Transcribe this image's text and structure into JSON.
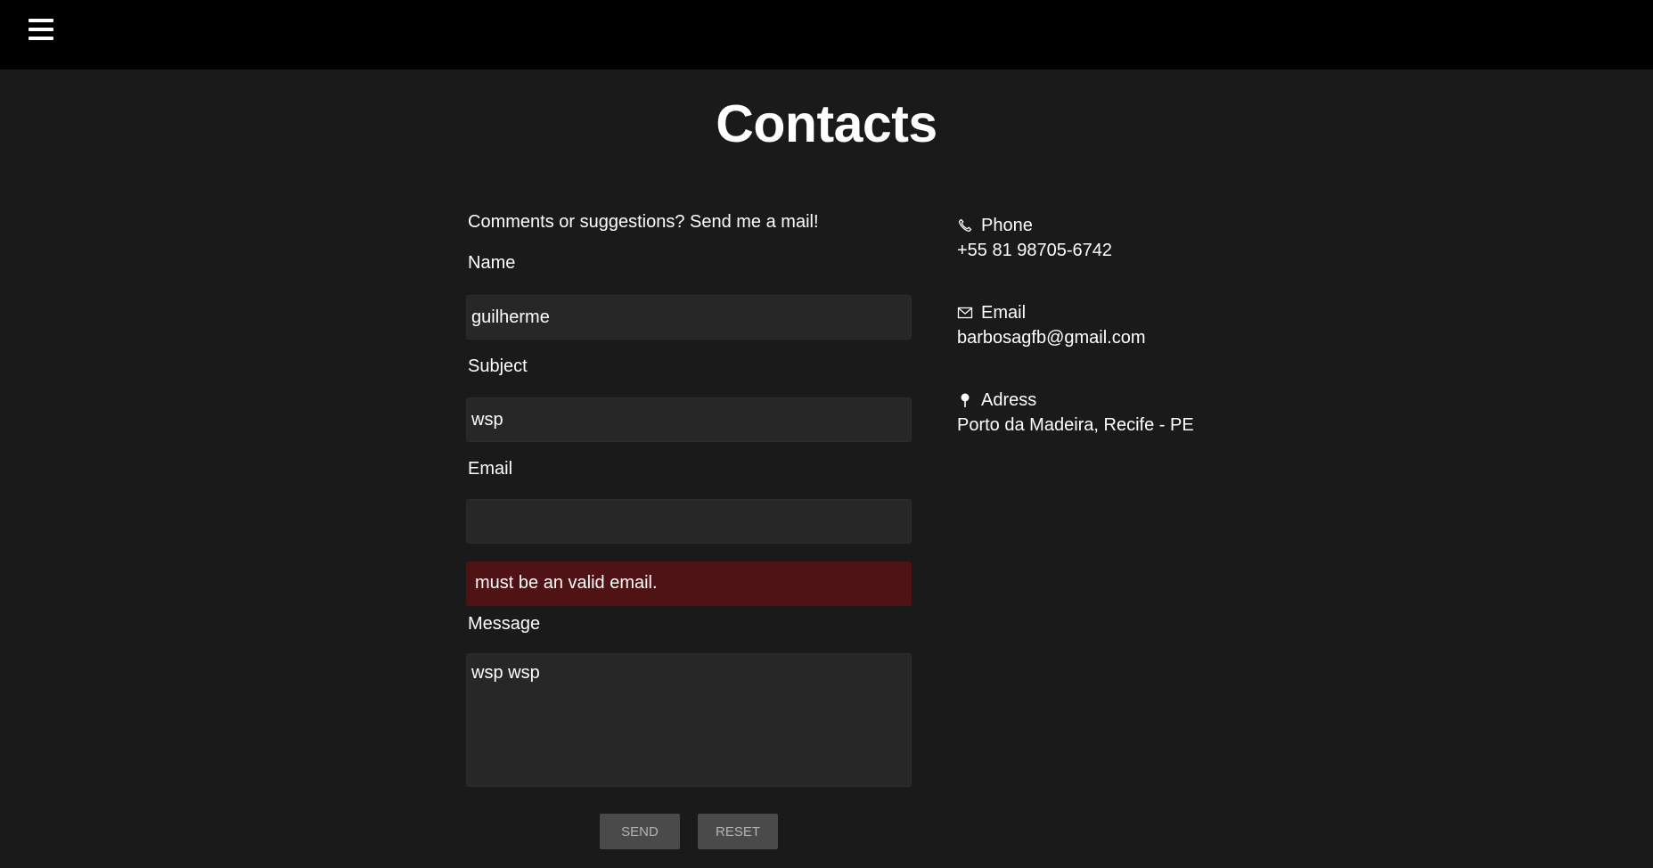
{
  "header": {
    "menu_icon": "hamburger-icon"
  },
  "page": {
    "title": "Contacts"
  },
  "form": {
    "intro": "Comments or suggestions? Send me a mail!",
    "name_label": "Name",
    "name_value": "guilherme",
    "subject_label": "Subject",
    "subject_value": "wsp",
    "email_label": "Email",
    "email_value": "",
    "email_error": "must be an valid email.",
    "message_label": "Message",
    "message_value": "wsp wsp",
    "send_label": "SEND",
    "reset_label": "RESET"
  },
  "contact_info": {
    "phone_label": "Phone",
    "phone_value": "+55 81 98705-6742",
    "phone_icon": "phone-icon",
    "email_label": "Email",
    "email_value": "barbosagfb@gmail.com",
    "email_icon": "envelope-icon",
    "address_label": "Adress",
    "address_value": "Porto da Madeira, Recife - PE",
    "address_icon": "map-pin-icon"
  },
  "colors": {
    "background": "#1a1a1a",
    "topbar": "#000000",
    "field_background": "#282728",
    "error_background": "#4f1315",
    "button_background": "#4a4a4a",
    "button_text": "#b3b3b3"
  }
}
